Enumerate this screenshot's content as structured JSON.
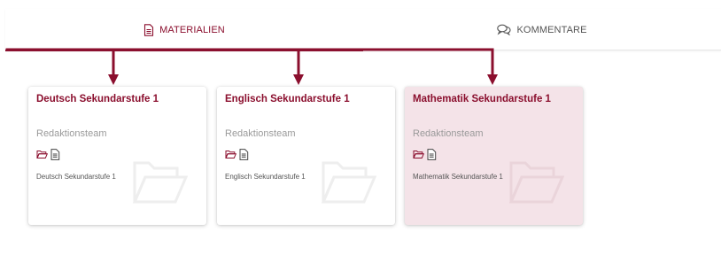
{
  "tabs": {
    "materialien_label": "MATERIALIEN",
    "kommentare_label": "KOMMENTARE"
  },
  "cards": [
    {
      "title": "Deutsch Sekundarstufe 1",
      "team": "Redaktionsteam",
      "description": "Deutsch Sekundarstufe 1"
    },
    {
      "title": "Englisch Sekundarstufe 1",
      "team": "Redaktionsteam",
      "description": "Englisch Sekundarstufe 1"
    },
    {
      "title": "Mathematik Sekundarstufe 1",
      "team": "Redaktionsteam",
      "description": "Mathematik Sekundarstufe 1"
    }
  ],
  "colors": {
    "accent": "#8b0f2e",
    "highlight_card": "#f4e3e8",
    "secondary_text": "#9a9a9a"
  },
  "icons": {
    "materialien_tab": "document-icon",
    "kommentare_tab": "comments-icon",
    "card_folder": "folder-open-icon",
    "card_document": "document-icon",
    "card_background": "folder-open-icon"
  }
}
